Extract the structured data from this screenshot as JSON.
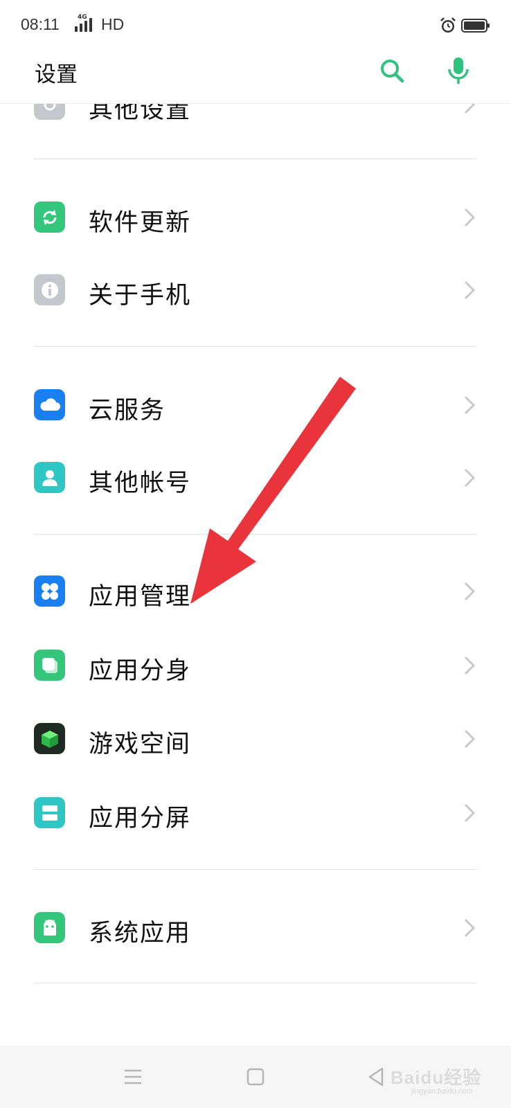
{
  "status_bar": {
    "time": "08:11",
    "network": "4G",
    "hd": "HD"
  },
  "header": {
    "title": "设置",
    "accent_color": "#2ec27e"
  },
  "settings_list": {
    "items": [
      {
        "label": "其他设置",
        "icon": "settings-icon",
        "color": "#c4c7cc"
      },
      {
        "label": "软件更新",
        "icon": "sync-icon",
        "color": "#34c77b"
      },
      {
        "label": "关于手机",
        "icon": "info-icon",
        "color": "#c4c7cc"
      },
      {
        "label": "云服务",
        "icon": "cloud-icon",
        "color": "#1a7ff0"
      },
      {
        "label": "其他帐号",
        "icon": "person-icon",
        "color": "#2fc7c4"
      },
      {
        "label": "应用管理",
        "icon": "grid-icon",
        "color": "#1a7ff0"
      },
      {
        "label": "应用分身",
        "icon": "clone-icon",
        "color": "#34c77b"
      },
      {
        "label": "游戏空间",
        "icon": "cube-icon",
        "color": "#1f2a22"
      },
      {
        "label": "应用分屏",
        "icon": "split-screen-icon",
        "color": "#2fc7c4"
      },
      {
        "label": "系统应用",
        "icon": "android-icon",
        "color": "#34c77b"
      }
    ]
  },
  "annotation": {
    "arrow_color": "#e8343a"
  },
  "watermark": {
    "text": "Baidu经验",
    "sub": "jingyan.baidu.com"
  }
}
